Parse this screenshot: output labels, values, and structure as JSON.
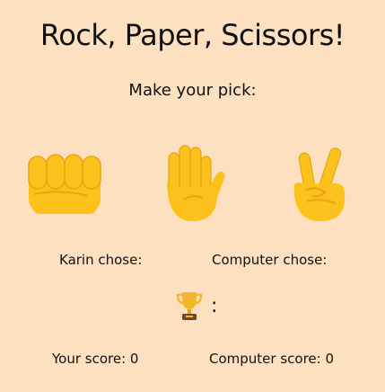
{
  "title": "Rock, Paper, Scissors!",
  "subtitle": "Make your pick:",
  "choices": [
    {
      "name": "rock",
      "icon": "fist-icon"
    },
    {
      "name": "paper",
      "icon": "raised-hand-icon"
    },
    {
      "name": "scissors",
      "icon": "victory-hand-icon"
    }
  ],
  "result": {
    "player_chose_label": "Karin chose:",
    "computer_chose_label": "Computer chose:",
    "winner_icon": "trophy-icon",
    "winner_separator": ":"
  },
  "score": {
    "player_label": "Your score: 0",
    "computer_label": "Computer score: 0"
  },
  "colors": {
    "background": "#fde0c0",
    "hand": "#fcc21b",
    "hand_shadow": "#e6a512",
    "trophy": "#f5b62b"
  }
}
